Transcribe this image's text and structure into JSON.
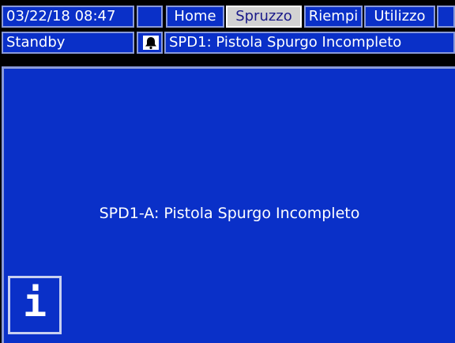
{
  "header": {
    "datetime": "03/22/18 08:47",
    "tabs": [
      {
        "label": "Home",
        "active": false
      },
      {
        "label": "Spruzzo",
        "active": true
      },
      {
        "label": "Riempi",
        "active": false
      },
      {
        "label": "Utilizzo",
        "active": false
      }
    ]
  },
  "status_bar": {
    "status": "Standby",
    "alarm_icon": "bell-icon",
    "alarm_text": "SPD1: Pistola Spurgo Incompleto"
  },
  "main": {
    "message": "SPD1-A: Pistola Spurgo Incompleto",
    "info_icon": "info-icon",
    "info_glyph": "i"
  },
  "colors": {
    "background": "#000000",
    "panel_blue": "#0a30c8",
    "border": "#8a9ad8",
    "active_tab_bg": "#d2d2d2",
    "active_tab_text": "#1a1a8a",
    "text": "#ffffff"
  }
}
